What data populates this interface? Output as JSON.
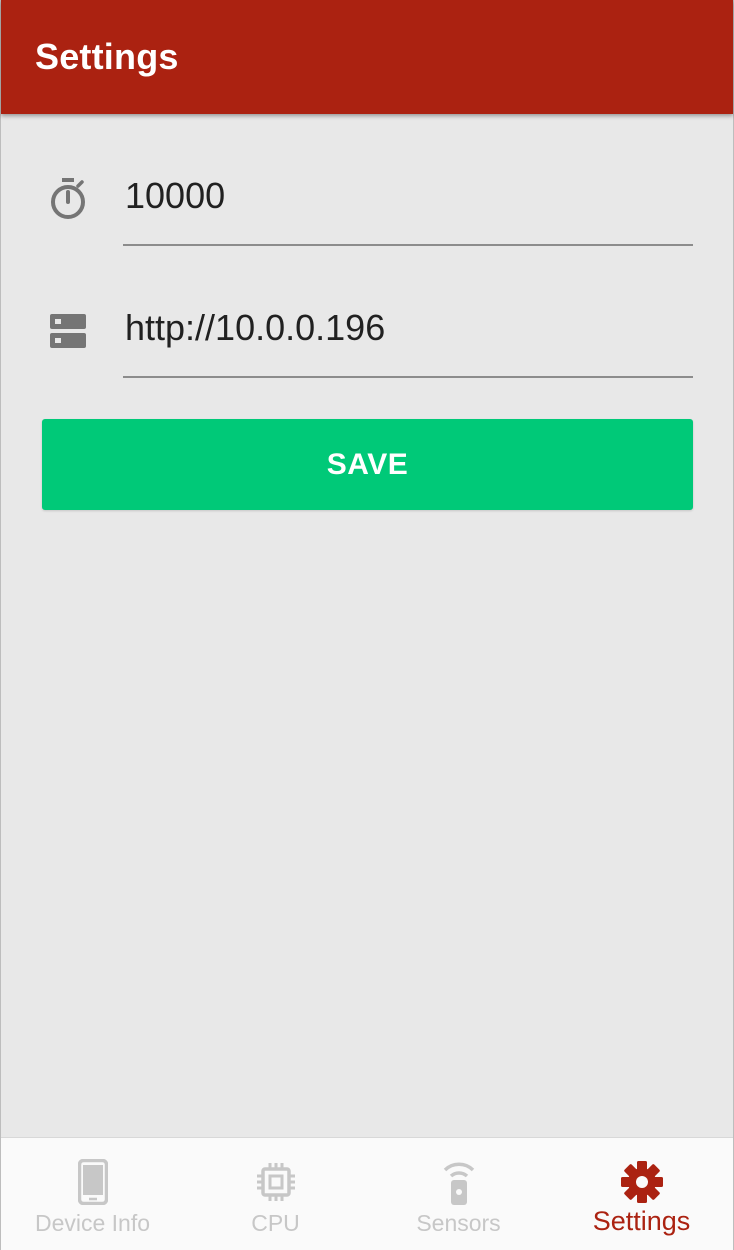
{
  "app_bar": {
    "title": "Settings"
  },
  "fields": [
    {
      "icon": "timer-icon",
      "value": "10000"
    },
    {
      "icon": "server-icon",
      "value": "http://10.0.0.196"
    }
  ],
  "save_button": {
    "label": "SAVE"
  },
  "bottom_nav": {
    "items": [
      {
        "label": "Device Info",
        "icon": "phone-icon",
        "active": false
      },
      {
        "label": "CPU",
        "icon": "chip-icon",
        "active": false
      },
      {
        "label": "Sensors",
        "icon": "sensor-icon",
        "active": false
      },
      {
        "label": "Settings",
        "icon": "gear-icon",
        "active": true
      }
    ]
  },
  "colors": {
    "primary": "#ab2211",
    "accent": "#00c978",
    "background": "#e8e8e8",
    "icon_gray": "#757575",
    "inactive_nav": "#c7c7c7"
  }
}
